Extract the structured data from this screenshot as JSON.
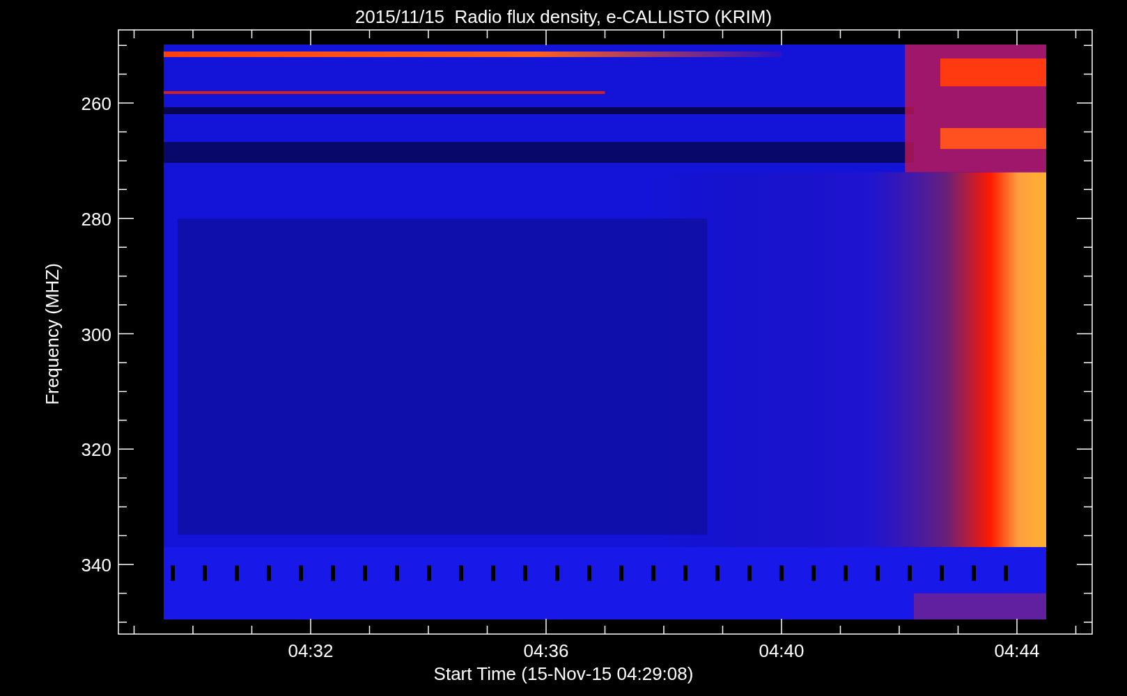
{
  "title": "2015/11/15  Radio flux density, e-CALLISTO (KRIM)",
  "ylabel": "Frequency (MHZ)",
  "xlabel": "Start Time (15-Nov-15 04:29:08)",
  "yticks": [
    "260",
    "280",
    "300",
    "320",
    "340"
  ],
  "xticks": [
    "04:32",
    "04:36",
    "04:40",
    "04:44"
  ]
}
